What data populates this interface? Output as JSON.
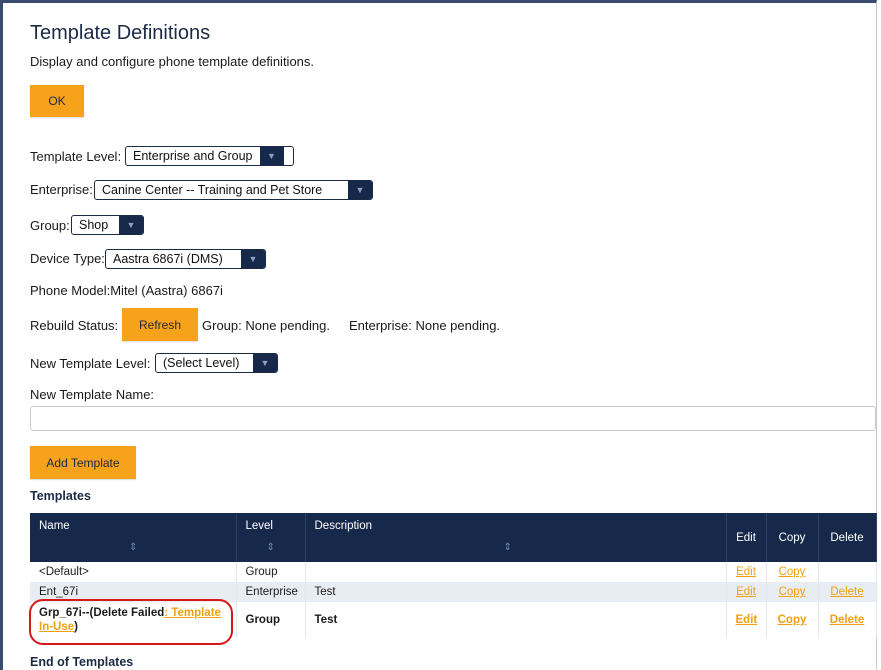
{
  "page": {
    "title": "Template Definitions",
    "subtitle": "Display and configure phone template definitions.",
    "ok_label": "OK"
  },
  "form": {
    "template_level_label": "Template Level:",
    "template_level_value": "Enterprise and Group",
    "enterprise_label": "Enterprise:",
    "enterprise_value": "Canine Center -- Training and Pet Store",
    "group_label": "Group:",
    "group_value": "Shop",
    "device_type_label": "Device Type:",
    "device_type_value": "Aastra 6867i (DMS)",
    "phone_model_text": "Phone Model:Mitel (Aastra) 6867i",
    "rebuild_status_label": "Rebuild Status:",
    "refresh_label": "Refresh",
    "group_status": "Group: None pending.",
    "enterprise_status": "Enterprise: None pending.",
    "new_template_level_label": "New Template Level:",
    "new_template_level_value": "(Select Level)",
    "new_template_name_label": "New Template Name:",
    "new_template_name_value": "",
    "add_template_label": "Add Template"
  },
  "templates": {
    "heading": "Templates",
    "columns": {
      "name": "Name",
      "level": "Level",
      "description": "Description",
      "edit": "Edit",
      "copy": "Copy",
      "delete": "Delete"
    },
    "rows": [
      {
        "name": "<Default>",
        "level": "Group",
        "description": "",
        "edit": "Edit",
        "copy": "Copy",
        "delete": ""
      },
      {
        "name": "Ent_67i",
        "level": "Enterprise",
        "description": "Test",
        "edit": "Edit",
        "copy": "Copy",
        "delete": "Delete"
      },
      {
        "name_prefix": "Grp_67i--(Delete Failed",
        "name_link": ": Template In-Use",
        "name_suffix": ")",
        "level": "Group",
        "description": "Test",
        "edit": "Edit",
        "copy": "Copy",
        "delete": "Delete"
      }
    ],
    "footer": "End of Templates"
  },
  "colors": {
    "accent": "#f7a21b",
    "navy": "#16294a",
    "highlight_ring": "#d81818"
  },
  "icons": {
    "dropdown": "chevron-down-icon",
    "sort": "sort-icon"
  }
}
